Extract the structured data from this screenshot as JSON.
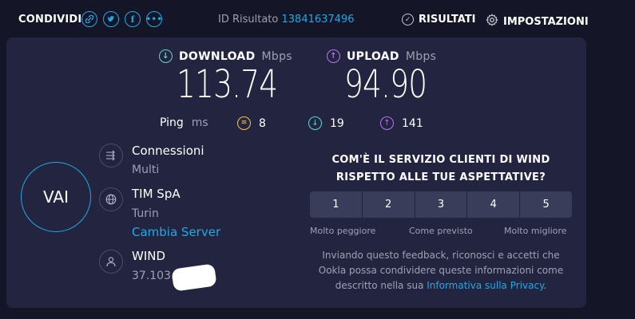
{
  "header": {
    "share_label": "CONDIVIDI",
    "share_icons": [
      "link-icon",
      "twitter-icon",
      "facebook-icon",
      "more-icon"
    ],
    "result_id_label": "ID Risultato",
    "result_id": "13841637496",
    "nav": {
      "results": "RISULTATI",
      "settings": "IMPOSTAZIONI"
    }
  },
  "speed": {
    "download": {
      "label": "DOWNLOAD",
      "unit": "Mbps",
      "value": "113.74"
    },
    "upload": {
      "label": "UPLOAD",
      "unit": "Mbps",
      "value": "94.90"
    }
  },
  "ping": {
    "label": "Ping",
    "unit": "ms",
    "idle": "8",
    "download": "19",
    "upload": "141"
  },
  "go_button": "VAI",
  "connections": {
    "title": "Connessioni",
    "value": "Multi"
  },
  "server": {
    "name": "TIM SpA",
    "location": "Turin",
    "change_link": "Cambia Server"
  },
  "provider": {
    "name": "WIND",
    "ip": "37.103."
  },
  "survey": {
    "question": "COM'È IL SERVIZIO CLIENTI DI WIND RISPETTO ALLE TUE ASPETTATIVE?",
    "options": [
      "1",
      "2",
      "3",
      "4",
      "5"
    ],
    "scale_low": "Molto peggiore",
    "scale_mid": "Come previsto",
    "scale_high": "Molto migliore",
    "feedback_text": "Inviando questo feedback, riconosci e accetti che Ookla possa condividere queste informazioni come descritto nella sua",
    "privacy_link": "Informativa sulla Privacy",
    "feedback_end": "."
  },
  "colors": {
    "accent": "#1fa9e6",
    "download": "#5bd6d1",
    "upload": "#b673f5",
    "ping_idle": "#f5c542",
    "background": "#141526",
    "panel": "#232540"
  }
}
